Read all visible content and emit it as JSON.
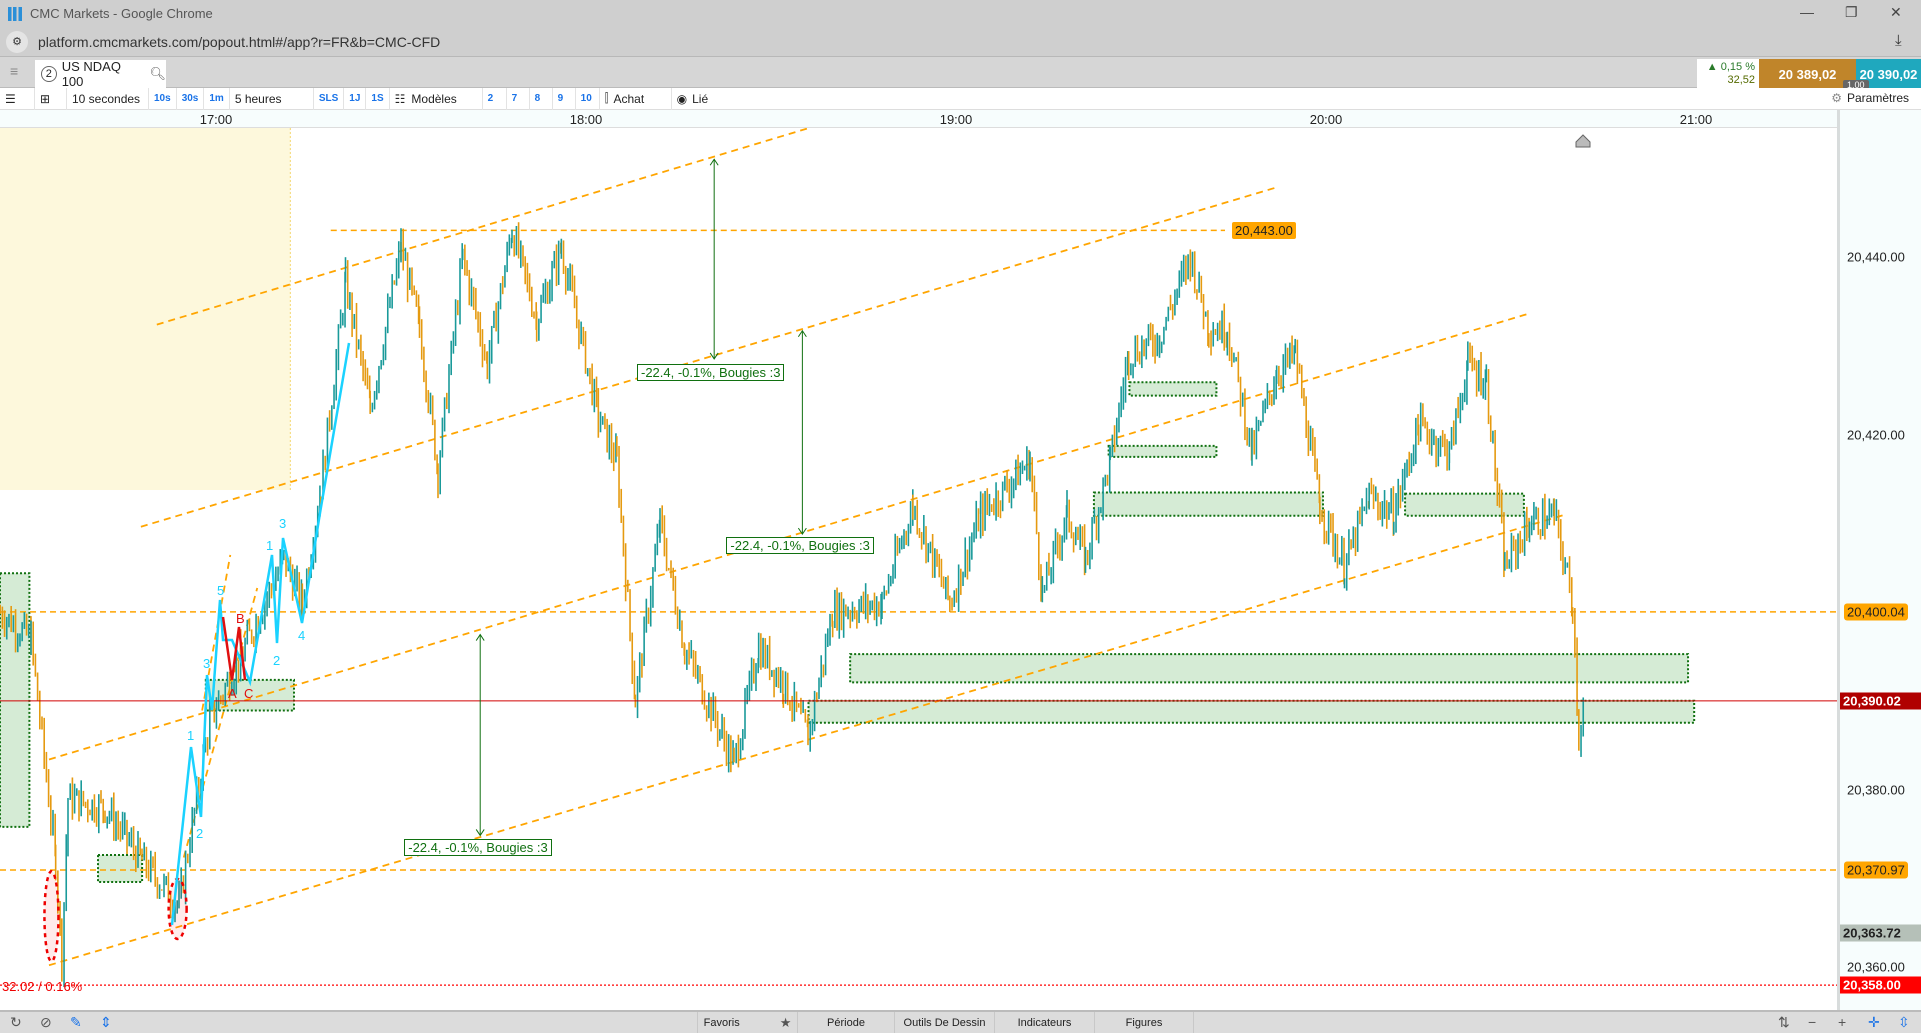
{
  "window": {
    "title": "CMC Markets - Google Chrome",
    "url": "platform.cmcmarkets.com/popout.html#/app?r=FR&b=CMC-CFD"
  },
  "tab": {
    "number": "2",
    "instrument": "US NDAQ 100"
  },
  "quote": {
    "change_pct": "▲ 0,15 %",
    "change_pts": "32,52",
    "sell": "20 389,02",
    "buy": "20 390,02",
    "lot": "1,00",
    "sell_color": "#c0852a",
    "buy_color": "#1fa8be"
  },
  "toolbar": {
    "interval": "10 secondes",
    "quick_intervals": [
      "10s",
      "30s",
      "1m"
    ],
    "range": "5 heures",
    "quick_ranges": [
      "SLS",
      "1J",
      "1S"
    ],
    "templates": "Modèles",
    "template_slots": [
      "2",
      "7",
      "8",
      "9",
      "10"
    ],
    "buy": "Achat",
    "linked": "Lié",
    "settings": "Paramètres"
  },
  "time_axis": [
    "17:00",
    "18:00",
    "19:00",
    "20:00",
    "21:00"
  ],
  "price_axis": {
    "ticks": [
      "20,440.00",
      "20,420.00",
      "20,380.00",
      "20,360.00"
    ],
    "labels": {
      "level_upper": "20,400.04",
      "current": "20,390.02",
      "level_lower": "20,370.97",
      "marker": "20,363.72",
      "low": "20,358.00",
      "top_level": "20,443.00"
    }
  },
  "annotations": {
    "range_label": "32.02 / 0.16%",
    "measure": [
      "-22.4, -0.1%, Bougies :3",
      "-22.4, -0.1%, Bougies :3",
      "-22.4, -0.1%, Bougies :3"
    ],
    "waves_cyan": [
      "1",
      "2",
      "3",
      "5",
      "1",
      "2",
      "3",
      "4"
    ],
    "waves_red": [
      "A",
      "B",
      "C"
    ]
  },
  "chart_data": {
    "type": "line",
    "instrument": "US NDAQ 100",
    "interval": "10 secondes",
    "price_range": [
      20356,
      20452
    ],
    "series": [
      [
        "16:25",
        20400
      ],
      [
        "16:30",
        20397
      ],
      [
        "16:34",
        20372
      ],
      [
        "16:35",
        20361
      ],
      [
        "16:36",
        20379
      ],
      [
        "16:42",
        20378
      ],
      [
        "16:48",
        20372
      ],
      [
        "16:54",
        20367
      ],
      [
        "16:59",
        20388
      ],
      [
        "17:04",
        20395
      ],
      [
        "17:11",
        20406
      ],
      [
        "17:14",
        20401
      ],
      [
        "17:17",
        20414
      ],
      [
        "17:21",
        20437
      ],
      [
        "17:25",
        20423
      ],
      [
        "17:30",
        20441
      ],
      [
        "17:33",
        20432
      ],
      [
        "17:36",
        20416
      ],
      [
        "17:40",
        20440
      ],
      [
        "17:44",
        20428
      ],
      [
        "17:48",
        20443
      ],
      [
        "17:52",
        20433
      ],
      [
        "17:56",
        20441
      ],
      [
        "18:02",
        20422
      ],
      [
        "18:05",
        20417
      ],
      [
        "18:08",
        20390
      ],
      [
        "18:12",
        20410
      ],
      [
        "18:16",
        20396
      ],
      [
        "18:24",
        20383
      ],
      [
        "18:28",
        20396
      ],
      [
        "18:32",
        20392
      ],
      [
        "18:36",
        20386
      ],
      [
        "18:40",
        20400
      ],
      [
        "18:48",
        20401
      ],
      [
        "18:53",
        20412
      ],
      [
        "18:59",
        20401
      ],
      [
        "19:04",
        20411
      ],
      [
        "19:12",
        20417
      ],
      [
        "19:14",
        20402
      ],
      [
        "19:18",
        20411
      ],
      [
        "19:21",
        20406
      ],
      [
        "19:25",
        20417
      ],
      [
        "19:28",
        20429
      ],
      [
        "19:33",
        20431
      ],
      [
        "19:38",
        20440
      ],
      [
        "19:41",
        20432
      ],
      [
        "19:44",
        20432
      ],
      [
        "19:48",
        20418
      ],
      [
        "19:52",
        20427
      ],
      [
        "19:55",
        20429
      ],
      [
        "19:59",
        20412
      ],
      [
        "20:03",
        20405
      ],
      [
        "20:07",
        20413
      ],
      [
        "20:11",
        20411
      ],
      [
        "20:15",
        20421
      ],
      [
        "20:20",
        20418
      ],
      [
        "20:23",
        20428
      ],
      [
        "20:26",
        20426
      ],
      [
        "20:29",
        20405
      ],
      [
        "20:33",
        20410
      ],
      [
        "20:37",
        20411
      ],
      [
        "20:40",
        20401
      ],
      [
        "20:41",
        20386
      ],
      [
        "20:42",
        20390
      ]
    ],
    "levels": {
      "upper": 20400.04,
      "current": 20390.02,
      "lower": 20370.97,
      "low": 20358.0,
      "top": 20443.0
    },
    "colors": {
      "up": "#1a9a9a",
      "down": "#e59a10",
      "level": "#ffa500",
      "current": "#d00000",
      "zone": "#d5ebd5"
    }
  },
  "bottom": {
    "tabs": [
      "Favoris",
      "Période",
      "Outils De Dessin",
      "Indicateurs",
      "Figures"
    ]
  }
}
